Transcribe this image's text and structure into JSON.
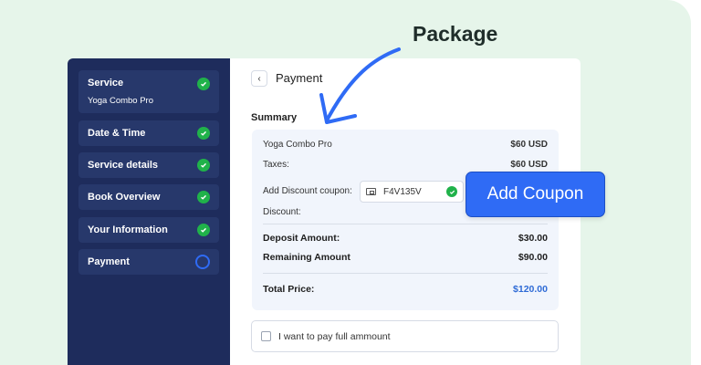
{
  "headline": "Package",
  "sidebar": {
    "steps": [
      {
        "title": "Service",
        "subtitle": "Yoga Combo Pro",
        "status": "done"
      },
      {
        "title": "Date & Time",
        "status": "done"
      },
      {
        "title": "Service details",
        "status": "done"
      },
      {
        "title": "Book Overview",
        "status": "done"
      },
      {
        "title": "Your Information",
        "status": "done"
      },
      {
        "title": "Payment",
        "status": "current"
      }
    ]
  },
  "main": {
    "title": "Payment",
    "back_icon": "chevron-left-icon",
    "summary_label": "Summary",
    "service": {
      "label": "Yoga Combo Pro",
      "value": "$60 USD"
    },
    "taxes": {
      "label": "Taxes:",
      "value": "$60 USD"
    },
    "coupon": {
      "label": "Add Discount coupon:",
      "code": "F4V135V"
    },
    "discount": {
      "label": "Discount:"
    },
    "deposit": {
      "label": "Deposit Amount:",
      "value": "$30.00"
    },
    "remaining": {
      "label": "Remaining Amount",
      "value": "$90.00"
    },
    "total": {
      "label": "Total Price:",
      "value": "$120.00"
    },
    "pay_full_label": "I want to pay full ammount"
  },
  "callout": {
    "label": "Add Coupon"
  },
  "colors": {
    "accent": "#2f6bf5",
    "sidebar": "#1e2c5c",
    "success": "#20b24a",
    "background": "#e6f5ea"
  }
}
